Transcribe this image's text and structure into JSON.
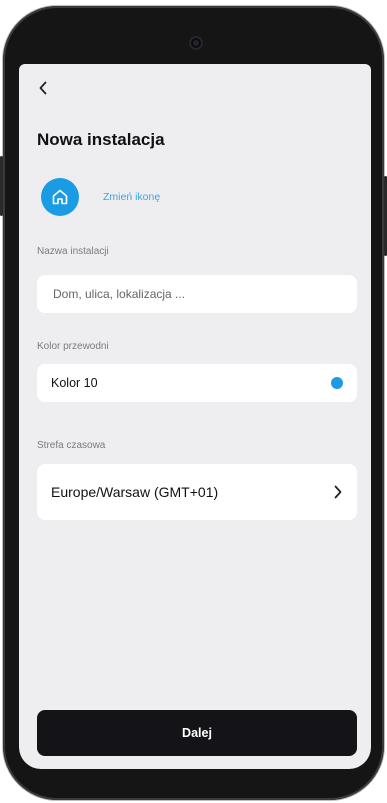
{
  "header": {
    "title": "Nowa instalacja"
  },
  "icon_section": {
    "change_label": "Zmień ikonę"
  },
  "fields": {
    "name": {
      "label": "Nazwa instalacji",
      "placeholder": "Dom, ulica, lokalizacja ...",
      "value": ""
    },
    "color": {
      "label": "Kolor przewodni",
      "value": "Kolor 10",
      "swatch": "#1b9be3"
    },
    "timezone": {
      "label": "Strefa czasowa",
      "value": "Europe/Warsaw (GMT+01)"
    }
  },
  "footer": {
    "next_label": "Dalej"
  },
  "colors": {
    "accent": "#1b9be3",
    "button_bg": "#141418",
    "screen_bg": "#eeeef1"
  },
  "icons": [
    "chevron-left-icon",
    "home-icon",
    "chevron-right-icon"
  ]
}
